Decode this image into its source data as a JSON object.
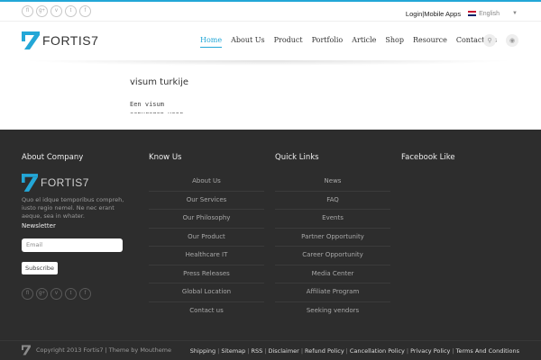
{
  "topbar": {
    "social": [
      "fl",
      "g+",
      "v",
      "t",
      "f"
    ],
    "social_icons": [
      "flickr-icon",
      "google-plus-icon",
      "vimeo-icon",
      "twitter-icon",
      "facebook-icon"
    ],
    "login_label": "Login",
    "mobile_label": "Mobile Apps",
    "language": "English"
  },
  "header": {
    "logo_text": "FORTIS7",
    "nav": [
      "Home",
      "About Us",
      "Product",
      "Portfolio",
      "Article",
      "Shop",
      "Resource",
      "Contact Us"
    ],
    "active_nav": "Home",
    "accent": "#23a7d7"
  },
  "content": {
    "title": "visum turkije",
    "body": "Een visum\naanvragen voor"
  },
  "footer": {
    "about": {
      "heading": "About Company",
      "logo_text": "FORTIS7",
      "description": "Quo el idque temporibus compreh, iusto regio nemel. Ne nec erant aeque, sea in whater.",
      "newsletter_label": "Newsletter",
      "email_placeholder": "Email",
      "subscribe_label": "Subscribe"
    },
    "know_us": {
      "heading": "Know Us",
      "links": [
        "About Us",
        "Our Services",
        "Our Philosophy",
        "Our Product",
        "Healthcare IT",
        "Press Releases",
        "Global Location",
        "Contact us"
      ]
    },
    "quick_links": {
      "heading": "Quick Links",
      "links": [
        "News",
        "FAQ",
        "Events",
        "Partner Opportunity",
        "Career Opportunity",
        "Media Center",
        "Affiliate Program",
        "Seeking vendors"
      ]
    },
    "facebook": {
      "heading": "Facebook Like"
    },
    "copyright": "Copyright 2013 Fortis7 | Theme by Moutheme",
    "bottom_links": [
      "Shipping",
      "Sitemap",
      "RSS",
      "Disclaimer",
      "Refund Policy",
      "Cancellation Policy",
      "Privacy Policy",
      "Terms And Conditions"
    ]
  }
}
